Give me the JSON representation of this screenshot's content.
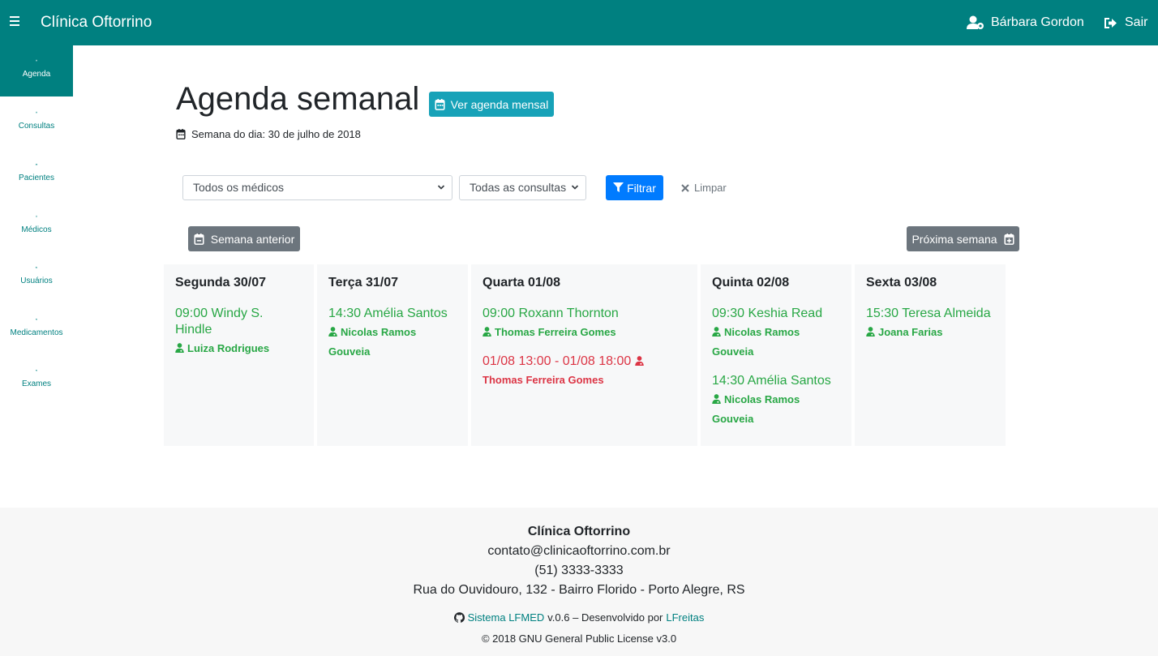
{
  "navbar": {
    "brand": "Clínica Oftorrino",
    "user_name": "Bárbara Gordon",
    "logout_label": "Sair"
  },
  "sidebar": {
    "items": [
      {
        "label": "Agenda",
        "icon": "calendar-icon",
        "active": true
      },
      {
        "label": "Consultas",
        "icon": "calendar-check-icon",
        "active": false
      },
      {
        "label": "Pacientes",
        "icon": "users-icon",
        "active": false
      },
      {
        "label": "Médicos",
        "icon": "user-md-icon",
        "active": false
      },
      {
        "label": "Usuários",
        "icon": "users-cog-icon",
        "active": false
      },
      {
        "label": "Medicamentos",
        "icon": "pills-icon",
        "active": false
      },
      {
        "label": "Exames",
        "icon": "capsules-icon",
        "active": false
      }
    ]
  },
  "header": {
    "title": "Agenda semanal",
    "monthly_button_label": "Ver agenda mensal",
    "week_of_label": "Semana do dia: 30 de julho de 2018"
  },
  "filters": {
    "doctor_select_value": "Todos os médicos",
    "appointment_select_value": "Todas as consultas",
    "filter_button_label": "Filtrar",
    "clear_label": "Limpar"
  },
  "navigation": {
    "previous_label": "Semana anterior",
    "next_label": "Próxima semana"
  },
  "days": [
    {
      "title": "Segunda 30/07",
      "appointments": [
        {
          "time_patient": "09:00 Windy S. Hindle",
          "doctor": "Luiza Rodrigues"
        }
      ]
    },
    {
      "title": "Terça 31/07",
      "appointments": [
        {
          "time_patient": "14:30 Amélia Santos",
          "doctor": "Nicolas Ramos Gouveia"
        }
      ]
    },
    {
      "title": "Quarta 01/08",
      "appointments": [
        {
          "time_patient": "09:00 Roxann Thornton",
          "doctor": "Thomas Ferreira Gomes"
        },
        {
          "time_patient": "01/08 13:00 - 01/08 18:00",
          "doctor": "Thomas Ferreira Gomes",
          "absence": true
        }
      ]
    },
    {
      "title": "Quinta 02/08",
      "appointments": [
        {
          "time_patient": "09:30 Keshia Read",
          "doctor": "Nicolas Ramos Gouveia"
        },
        {
          "time_patient": "14:30 Amélia Santos",
          "doctor": "Nicolas Ramos Gouveia"
        }
      ]
    },
    {
      "title": "Sexta 03/08",
      "appointments": [
        {
          "time_patient": "15:30 Teresa Almeida",
          "doctor": "Joana Farias"
        }
      ]
    }
  ],
  "footer": {
    "clinic_name": "Clínica Oftorrino",
    "email": "contato@clinicaoftorrino.com.br",
    "phone": "(51) 3333-3333",
    "address": "Rua do Ouvidouro, 132 - Bairro Florido - Porto Alegre, RS",
    "system_link": "Sistema LFMED",
    "credit_middle": "v.0.6 – Desenvolvido por",
    "author_link": "LFreitas",
    "license": "© 2018 GNU General Public License v3.0"
  },
  "colors": {
    "primary": "#008080",
    "info": "#17a2b8",
    "filter_blue": "#007bff",
    "secondary": "#6c757d",
    "success": "#28a745",
    "danger": "#dc3545"
  }
}
